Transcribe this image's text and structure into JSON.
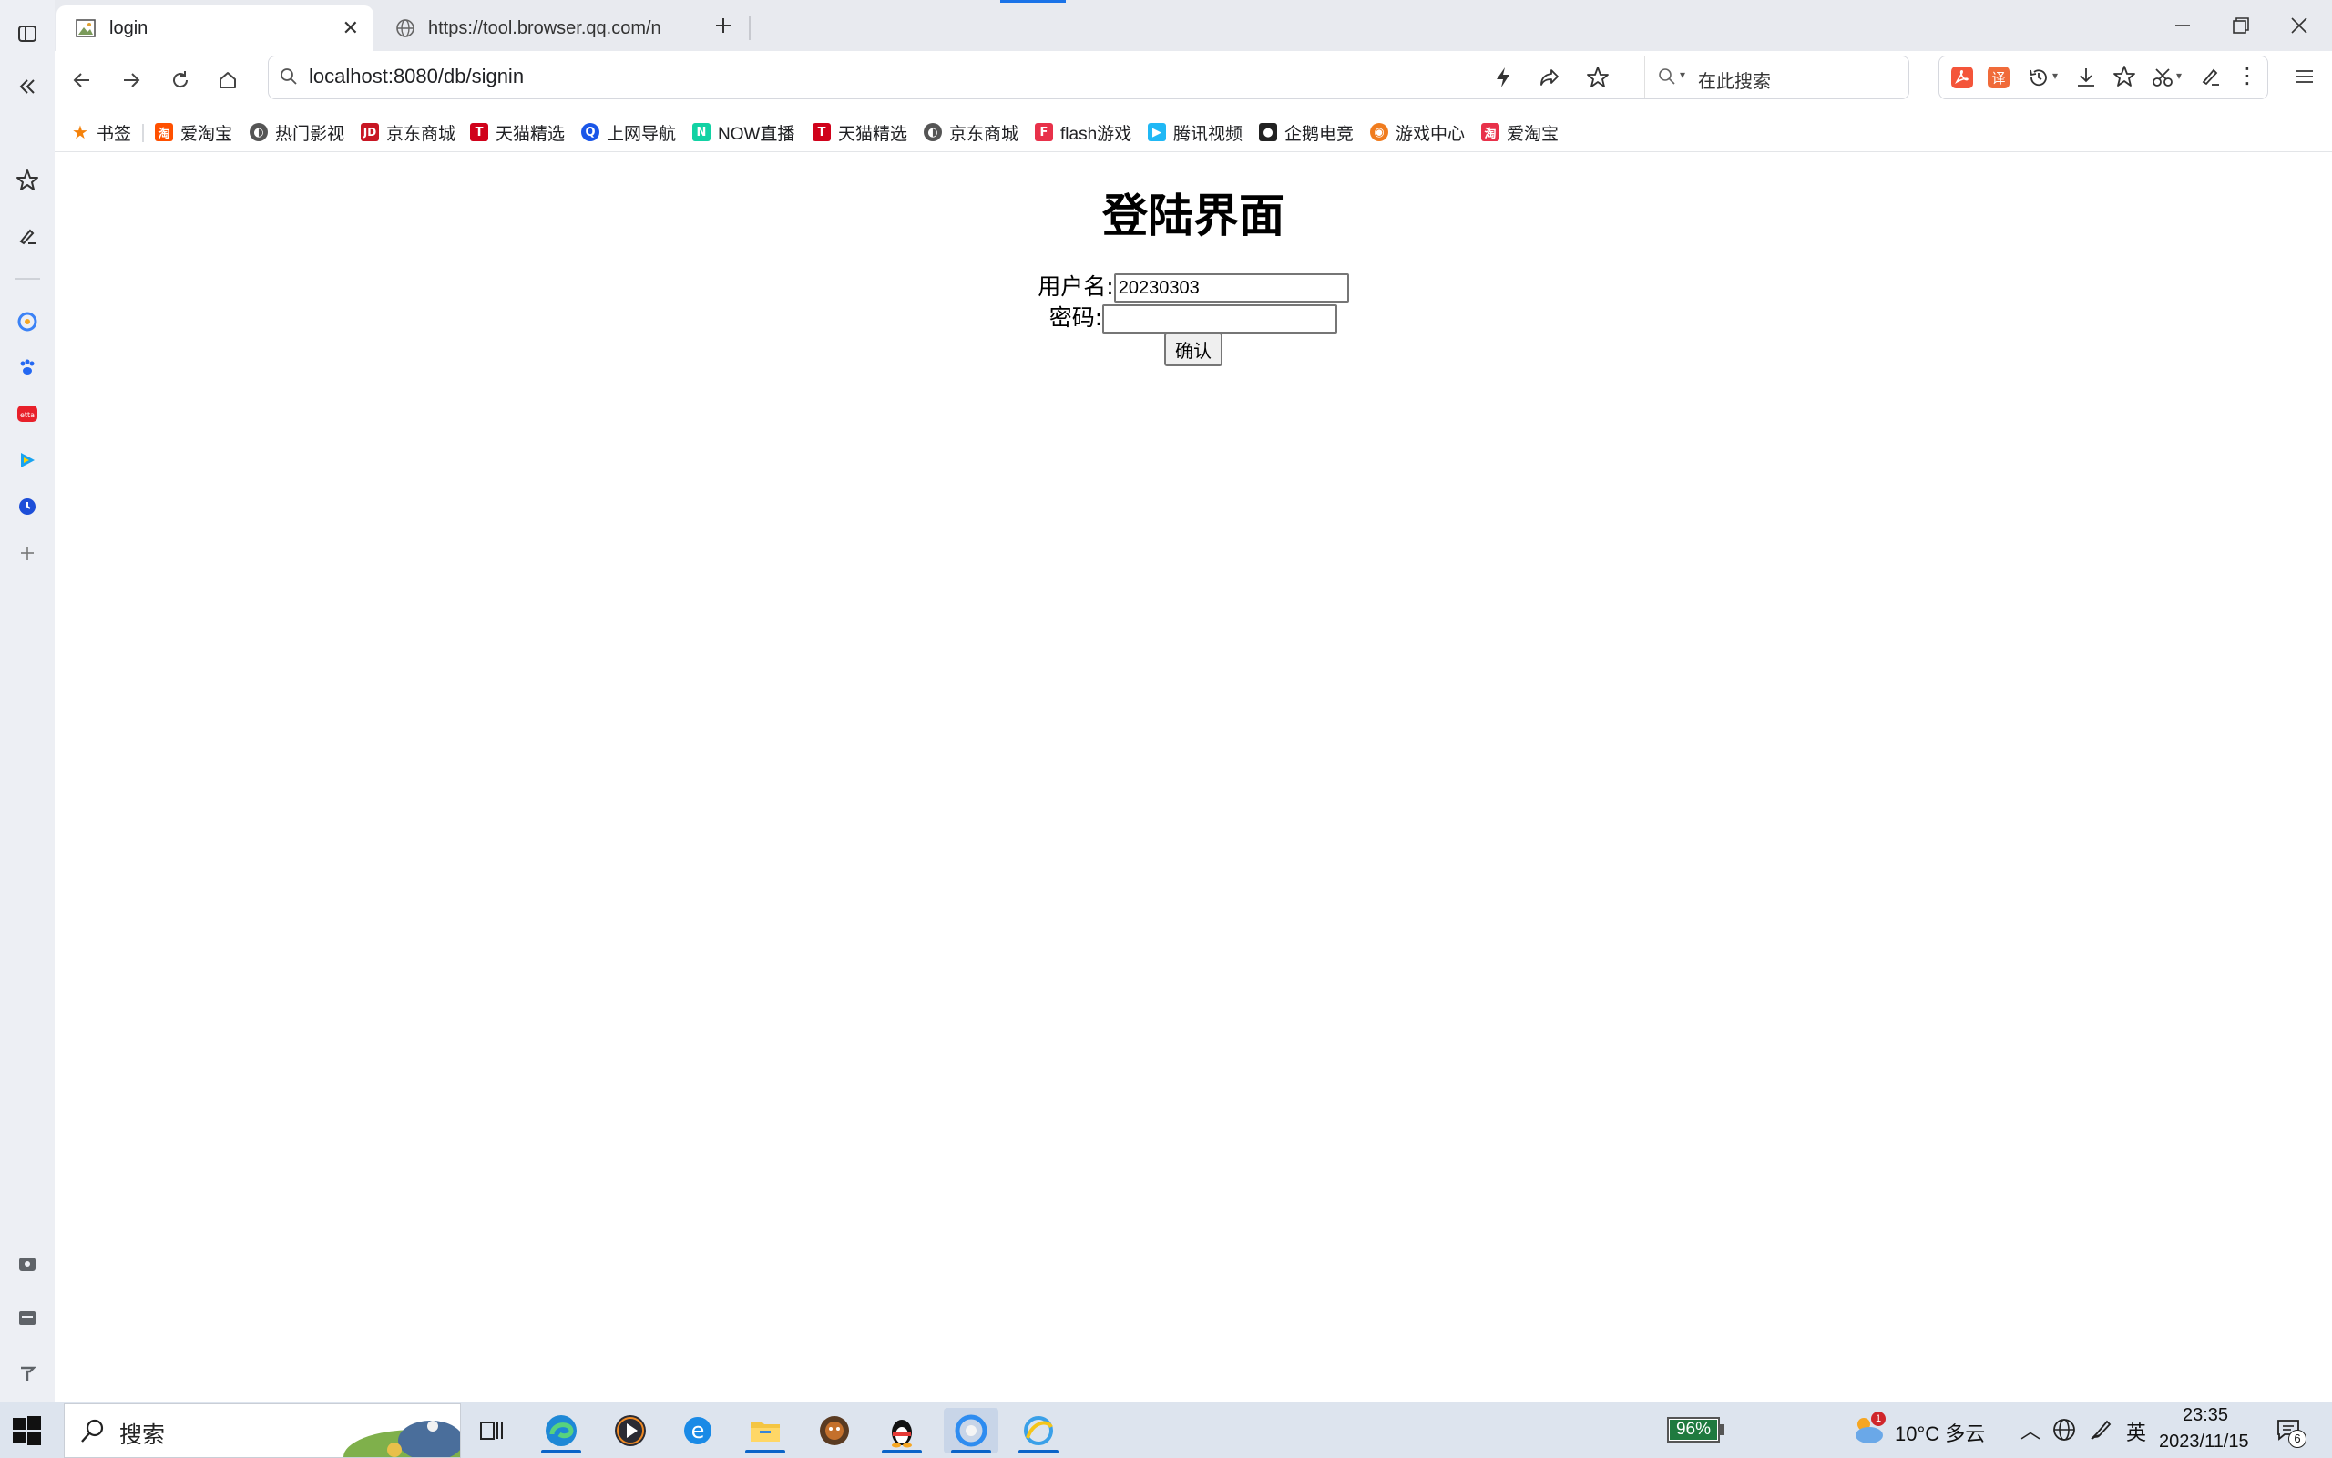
{
  "browser": {
    "tabs": [
      {
        "title": "login",
        "active": true
      },
      {
        "title": "https://tool.browser.qq.com/n",
        "active": false
      }
    ],
    "address": "localhost:8080/db/signin",
    "search_placeholder": "在此搜索"
  },
  "bookmarks": [
    {
      "label": "书签",
      "icon": "star-icon",
      "color": "#f5820a"
    },
    {
      "label": "爱淘宝",
      "icon": "taobao-icon",
      "color": "#ff5000"
    },
    {
      "label": "热门影视",
      "icon": "globe-icon",
      "color": "#555555"
    },
    {
      "label": "京东商城",
      "icon": "jd-icon",
      "color": "#c81623"
    },
    {
      "label": "天猫精选",
      "icon": "tmall-icon",
      "color": "#d0021b"
    },
    {
      "label": "上网导航",
      "icon": "nav-icon",
      "color": "#1a56e8"
    },
    {
      "label": "NOW直播",
      "icon": "now-icon",
      "color": "#12d2a4"
    },
    {
      "label": "天猫精选",
      "icon": "tmall-icon",
      "color": "#d0021b"
    },
    {
      "label": "京东商城",
      "icon": "globe-icon",
      "color": "#555555"
    },
    {
      "label": "flash游戏",
      "icon": "flash-icon",
      "color": "#e8314a"
    },
    {
      "label": "腾讯视频",
      "icon": "tencent-video-icon",
      "color": "#20b8f5"
    },
    {
      "label": "企鹅电竞",
      "icon": "esports-icon",
      "color": "#222222"
    },
    {
      "label": "游戏中心",
      "icon": "gamepad-icon",
      "color": "#f07c1e"
    },
    {
      "label": "爱淘宝",
      "icon": "taobao-icon",
      "color": "#e8314a"
    }
  ],
  "page": {
    "heading": "登陆界面",
    "username_label": "用户名:",
    "username_value": "20230303",
    "password_label": "密码:",
    "password_value": "",
    "submit_label": "确认"
  },
  "taskbar": {
    "search_text": "搜索",
    "battery": "96%",
    "weather": "10°C 多云",
    "ime": "英",
    "time": "23:35",
    "date": "2023/11/15",
    "notifications": "6",
    "weather_alert": "1"
  },
  "colors": {
    "accent": "#0a64c8",
    "sidebar_bg": "#edeff4",
    "tabstrip_bg": "#e8eaef",
    "taskbar_bg": "#dde4ee"
  }
}
